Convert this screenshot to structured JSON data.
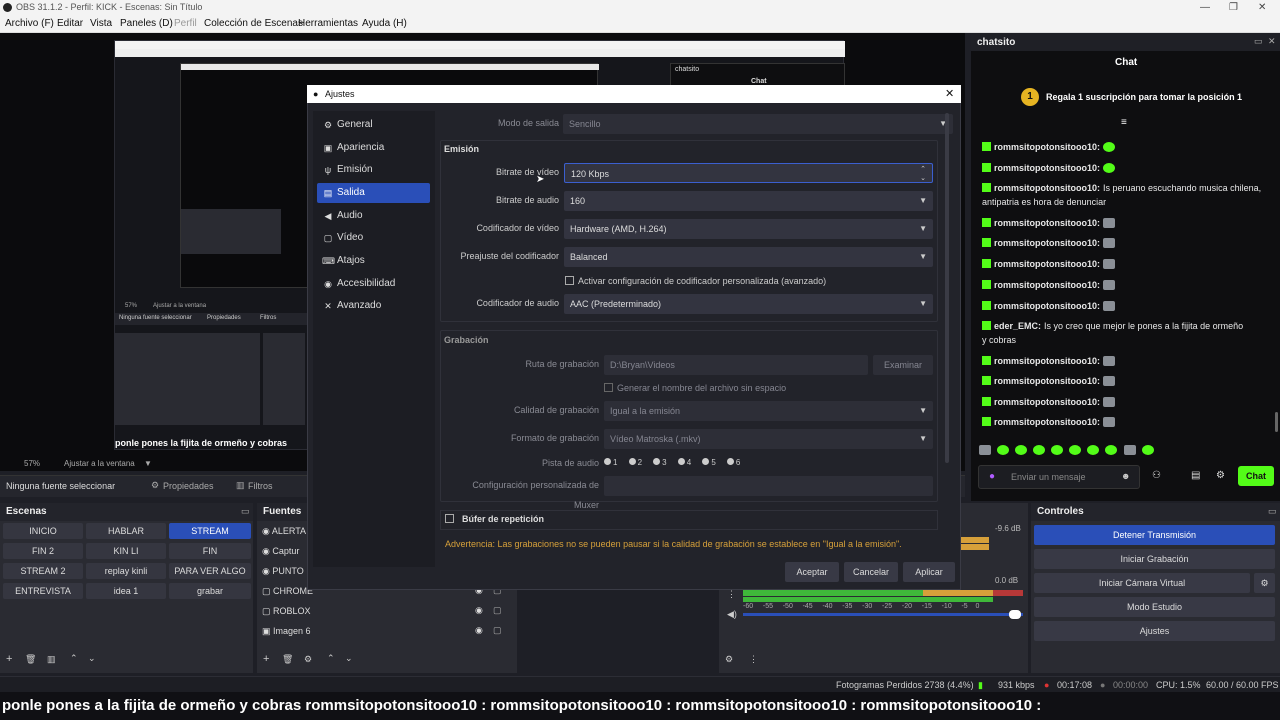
{
  "window": {
    "title": "OBS 31.1.2 - Perfil: KICK - Escenas: Sin Título"
  },
  "menu": [
    "Archivo (F)",
    "Editar",
    "Vista",
    "Paneles (D)",
    "Perfil",
    "Colección de Escenas",
    "Herramientas",
    "Ayuda (H)"
  ],
  "preview": {
    "nested_text": "ponle pones la fijita de ormeño y cobras",
    "zoom": "57%",
    "fit": "Ajustar a la ventana",
    "no_source": "Ninguna fuente seleccionar",
    "props": "Propiedades",
    "filters": "Filtros",
    "nested_zoom": "57%",
    "nested_fit": "Ajustar a la ventana",
    "nested_no_source": "Ninguna fuente seleccionar",
    "nested_props": "Propiedades",
    "nested_filters": "Filtros",
    "nested_chat": "chatsito",
    "nested_chat_title": "Chat"
  },
  "scenes": {
    "title": "Escenas",
    "items": [
      "INICIO",
      "HABLAR",
      "STREAM",
      "FIN 2",
      "KIN LI",
      "FIN",
      "STREAM 2",
      "replay kinli",
      "PARA VER ALGO",
      "ENTREVISTA",
      "idea 1",
      "grabar"
    ]
  },
  "sources": {
    "title": "Fuentes",
    "items": [
      "ALERTA",
      "Captur",
      "PUNTO",
      "CHROME",
      "ROBLOX",
      "Imagen 6"
    ]
  },
  "mixer": {
    "db1": "-9.6 dB",
    "db2": "0.0 dB",
    "scale": [
      "-60",
      "-55",
      "-50",
      "-45",
      "-40",
      "-35",
      "-30",
      "-25",
      "-20",
      "-15",
      "-10",
      "-5",
      "0"
    ]
  },
  "controls": {
    "title": "Controles",
    "buttons": [
      "Detener Transmisión",
      "Iniciar Grabación",
      "Iniciar Cámara Virtual",
      "Modo Estudio",
      "Ajustes"
    ]
  },
  "status": {
    "dropped": "Fotogramas Perdidos 2738 (4.4%)",
    "kbps": "931 kbps",
    "live": "00:17:08",
    "rec": "00:00:00",
    "cpu": "CPU: 1.5%",
    "fps": "60.00 / 60.00 FPS"
  },
  "ticker": "ponle pones a la fijita de ormeño y cobras  rommsitopotonsitooo10 :   rommsitopotonsitooo10 :   rommsitopotonsitooo10 :   rommsitopotonsitooo10 :",
  "chat": {
    "dock_title": "chatsito",
    "title": "Chat",
    "gift_banner": "Regala 1 suscripción para tomar la posición 1",
    "gift_num": "1",
    "messages": [
      {
        "user": "rommsitopotonsitooo10:",
        "text": "",
        "emote": "green"
      },
      {
        "user": "rommsitopotonsitooo10:",
        "text": "",
        "emote": "green"
      },
      {
        "user": "rommsitopotonsitooo10:",
        "text": "Is peruano escuchando musica chilena,",
        "emote": ""
      },
      {
        "user": "",
        "text": "antipatria es hora de denunciar",
        "emote": ""
      },
      {
        "user": "rommsitopotonsitooo10:",
        "text": "",
        "emote": "gray"
      },
      {
        "user": "rommsitopotonsitooo10:",
        "text": "",
        "emote": "gray"
      },
      {
        "user": "rommsitopotonsitooo10:",
        "text": "",
        "emote": "gray"
      },
      {
        "user": "rommsitopotonsitooo10:",
        "text": "",
        "emote": "gray"
      },
      {
        "user": "rommsitopotonsitooo10:",
        "text": "",
        "emote": "gray"
      },
      {
        "user": "eder_EMC:",
        "text": "Is yo creo que mejor le pones a la fijita de ormeño",
        "emote": ""
      },
      {
        "user": "",
        "text": "y cobras",
        "emote": ""
      },
      {
        "user": "rommsitopotonsitooo10:",
        "text": "",
        "emote": "gray"
      },
      {
        "user": "rommsitopotonsitooo10:",
        "text": "",
        "emote": "gray"
      },
      {
        "user": "rommsitopotonsitooo10:",
        "text": "",
        "emote": "gray"
      },
      {
        "user": "rommsitopotonsitooo10:",
        "text": "",
        "emote": "gray"
      }
    ],
    "input_placeholder": "Enviar un mensaje",
    "send": "Chat"
  },
  "settings": {
    "title": "Ajustes",
    "nav": [
      "General",
      "Apariencia",
      "Emisión",
      "Salida",
      "Audio",
      "Vídeo",
      "Atajos",
      "Accesibilidad",
      "Avanzado"
    ],
    "nav_icons": [
      "⚙",
      "▣",
      "ψ",
      "▤",
      "◀",
      "▢",
      "⌨",
      "◉",
      "✕"
    ],
    "output_mode_label": "Modo de salida",
    "output_mode": "Sencillo",
    "stream_section": "Emisión",
    "video_bitrate_label": "Bitrate de vídeo",
    "video_bitrate": "120 Kbps",
    "audio_bitrate_label": "Bitrate de audio",
    "audio_bitrate": "160",
    "video_encoder_label": "Codificador de vídeo",
    "video_encoder": "Hardware (AMD, H.264)",
    "preset_label": "Preajuste del codificador",
    "preset": "Balanced",
    "custom_enc": "Activar configuración de codificador personalizada (avanzado)",
    "audio_encoder_label": "Codificador de audio",
    "audio_encoder": "AAC (Predeterminado)",
    "rec_section": "Grabación",
    "rec_path_label": "Ruta de grabación",
    "rec_path": "D:\\Bryan\\Videos",
    "browse": "Examinar",
    "no_space": "Generar el nombre del archivo sin espacio",
    "rec_quality_label": "Calidad de grabación",
    "rec_quality": "Igual a la emisión",
    "rec_format_label": "Formato de grabación",
    "rec_format": "Vídeo Matroska (.mkv)",
    "audio_track_label": "Pista de audio",
    "tracks": [
      "1",
      "2",
      "3",
      "4",
      "5",
      "6"
    ],
    "muxer_label": "Configuración personalizada de Muxer",
    "replay_buffer": "Búfer de repetición",
    "warning": "Advertencia: Las grabaciones no se pueden pausar si la calidad de grabación se establece en \"Igual a la emisión\".",
    "ok": "Aceptar",
    "cancel": "Cancelar",
    "apply": "Aplicar"
  },
  "colors": {
    "accent": "#2a4fb8",
    "kick_green": "#53fc18",
    "warning": "#d6a03a"
  }
}
